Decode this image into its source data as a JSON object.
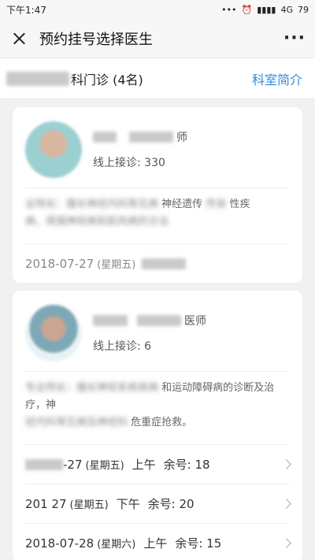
{
  "status": {
    "time": "下午1:47",
    "network": "4G",
    "battery": "79"
  },
  "header": {
    "title": "预约挂号选择医生",
    "more": "···"
  },
  "dept": {
    "name_visible": "科门诊 (4名)",
    "link": "科室简介"
  },
  "doctors": [
    {
      "title_suffix": "师",
      "consult": "线上接诊: 330",
      "specialty_line1_visible": "神经遗传",
      "specialty_line1_tail": "性疾",
      "slot_date": "2018-07-27",
      "slot_weekday": "(星期五)"
    },
    {
      "title_suffix": "医师",
      "consult": "线上接诊: 6",
      "specialty_line1": "和运动障碍病的诊断及治疗，神",
      "specialty_line2": "危重症抢救。"
    }
  ],
  "slots": [
    {
      "date": "-27",
      "weekday": "(星期五)",
      "period": "上午",
      "remain": "余号: 18"
    },
    {
      "date": "201   27",
      "weekday": "(星期五)",
      "period": "下午",
      "remain": "余号: 20"
    },
    {
      "date": "2018-07-28",
      "weekday": "(星期六)",
      "period": "上午",
      "remain": "余号: 15"
    }
  ]
}
